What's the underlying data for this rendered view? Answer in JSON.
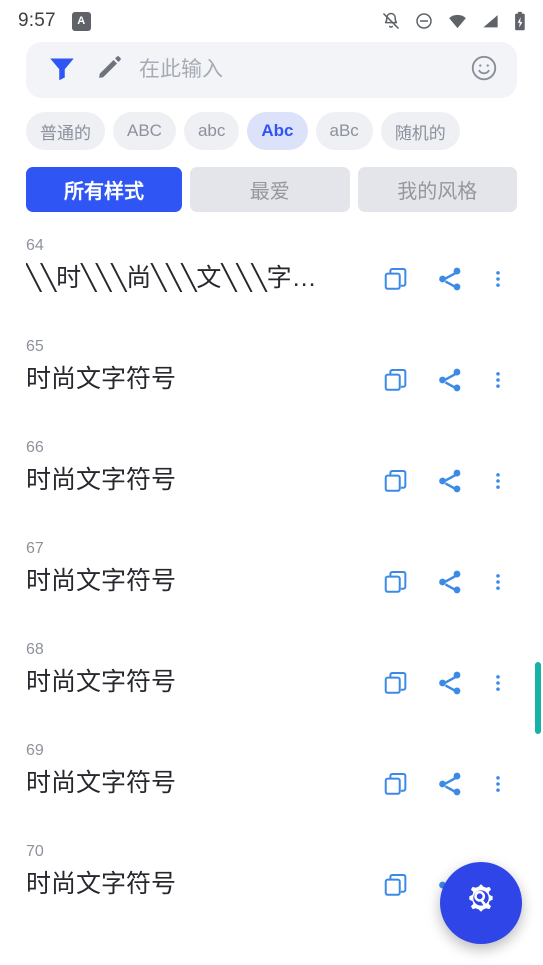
{
  "status_bar": {
    "time": "9:57",
    "app_badge_letter": "A",
    "icons": [
      "notifications-off-icon",
      "do-not-disturb-icon",
      "wifi-icon",
      "signal-icon",
      "battery-charging-icon"
    ]
  },
  "search": {
    "placeholder": "在此输入",
    "value": "",
    "filter_icon": "filter-icon",
    "edit_icon": "pencil-icon",
    "emoji_icon": "emoji-icon"
  },
  "case_chips": [
    {
      "label": "普通的",
      "selected": false
    },
    {
      "label": "ABC",
      "selected": false
    },
    {
      "label": "abc",
      "selected": false
    },
    {
      "label": "Abc",
      "selected": true
    },
    {
      "label": "aBc",
      "selected": false
    },
    {
      "label": "随机的",
      "selected": false
    }
  ],
  "tabs": [
    {
      "label": "所有样式",
      "active": true
    },
    {
      "label": "最爱",
      "active": false
    },
    {
      "label": "我的风格",
      "active": false
    }
  ],
  "list": {
    "row_actions": {
      "copy_icon": "copy-icon",
      "share_icon": "share-icon",
      "more_icon": "more-vertical-icon"
    },
    "rows": [
      {
        "number": "64",
        "text": "╲╲时╲╲╲尚╲╲╲文╲╲╲字…"
      },
      {
        "number": "65",
        "text": "时尚文字符号"
      },
      {
        "number": "66",
        "text": "时尚文字符号"
      },
      {
        "number": "67",
        "text": "时尚文字符号"
      },
      {
        "number": "68",
        "text": "时尚文字符号"
      },
      {
        "number": "69",
        "text": "时尚文字符号"
      },
      {
        "number": "70",
        "text": "时尚文字符号"
      }
    ]
  },
  "scrollbar": {
    "thumb_color": "#16b2a6"
  },
  "fab": {
    "icon": "settings-wrench-icon",
    "color": "#2f45e8"
  },
  "colors": {
    "accent_blue": "#2f55f5",
    "icon_blue": "#3b8ae8",
    "chip_bg": "#eef0f4",
    "chip_selected_bg": "#dde2fb",
    "tab_bg": "#e4e5ea",
    "search_bg": "#f3f4f8"
  }
}
